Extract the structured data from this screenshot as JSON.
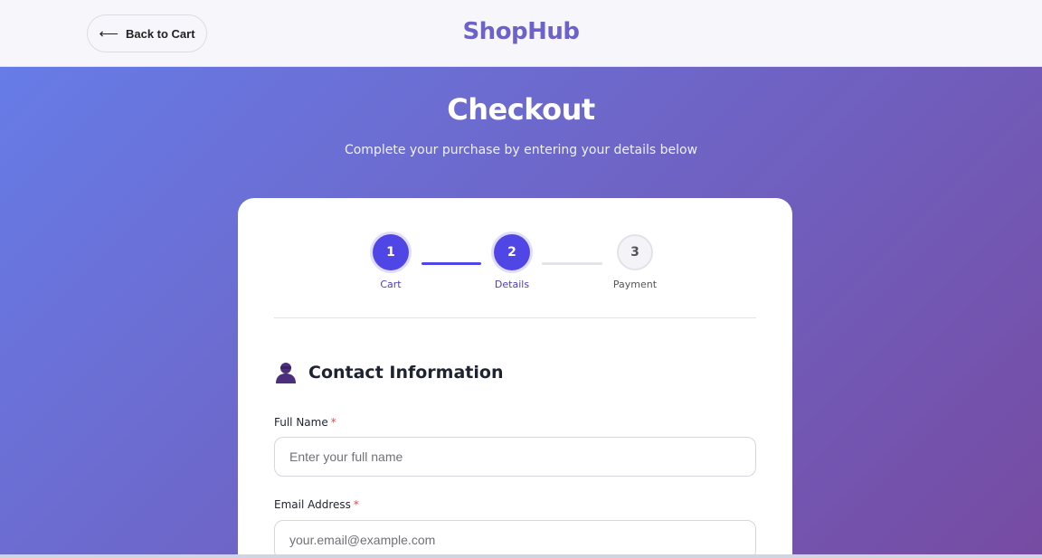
{
  "header": {
    "back_label": "Back to Cart",
    "back_icon": "arrow-left-icon",
    "logo": "ShopHub"
  },
  "hero": {
    "title": "Checkout",
    "subtitle": "Complete your purchase by entering your details below"
  },
  "steps": [
    {
      "number": "1",
      "label": "Cart",
      "state": "complete"
    },
    {
      "number": "2",
      "label": "Details",
      "state": "current"
    },
    {
      "number": "3",
      "label": "Payment",
      "state": "upcoming"
    }
  ],
  "contact": {
    "title": "Contact Information",
    "icon": "user-icon",
    "fields": [
      {
        "label": "Full Name",
        "required_mark": "*",
        "placeholder": "Enter your full name",
        "value": ""
      },
      {
        "label": "Email Address",
        "required_mark": "*",
        "placeholder": "your.email@example.com",
        "value": ""
      }
    ]
  },
  "colors": {
    "accent": "#4f46e5",
    "logo": "#6b63c9",
    "gradient_start": "#667eea",
    "gradient_end": "#764ba2",
    "required": "#e04848"
  }
}
